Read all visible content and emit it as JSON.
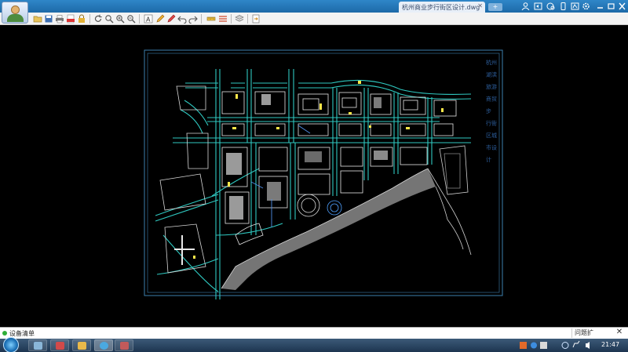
{
  "titlebar": {
    "document_tab": "杭州商业步行街区设计.dwg",
    "new_tab_label": "+",
    "icons": [
      "user-icon",
      "feedback-icon",
      "chat-icon",
      "phone-icon",
      "cloud-icon",
      "settings-icon",
      "minimize-icon",
      "maximize-icon",
      "close-icon"
    ]
  },
  "toolbar": {
    "tools": [
      "open-folder-icon",
      "save-icon",
      "print-icon",
      "export-pdf-icon",
      "lock-icon",
      "refresh-icon",
      "zoom-window-icon",
      "zoom-in-icon",
      "zoom-out-icon",
      "text-icon",
      "pencil-icon",
      "markup-pen-icon",
      "undo-icon",
      "redo-icon",
      "measure-icon",
      "hatch-icon",
      "layers-icon",
      "export-icon"
    ]
  },
  "drawing": {
    "title_chars": [
      "杭州",
      "湖滨",
      "旅游",
      "商贸",
      "步",
      "行街",
      "区城",
      "市设",
      "计"
    ]
  },
  "status": {
    "left_text": "设备清单",
    "feedback_label": "问题扩",
    "close_symbol": "✕",
    "status_color": "#2fae38"
  },
  "taskbar": {
    "clock": "21:47",
    "apps": [
      "photos-app",
      "paint-app",
      "folder-app",
      "browser-app",
      "stack-app"
    ]
  },
  "colors": {
    "titlebar": "#2b7fc0",
    "drawing_frame": "#3d7fae",
    "road_lines": "#2fc8c0",
    "building_lines": "#e8e8e8",
    "highlight": "#ffe84a",
    "title_text": "#2d5f9e"
  }
}
